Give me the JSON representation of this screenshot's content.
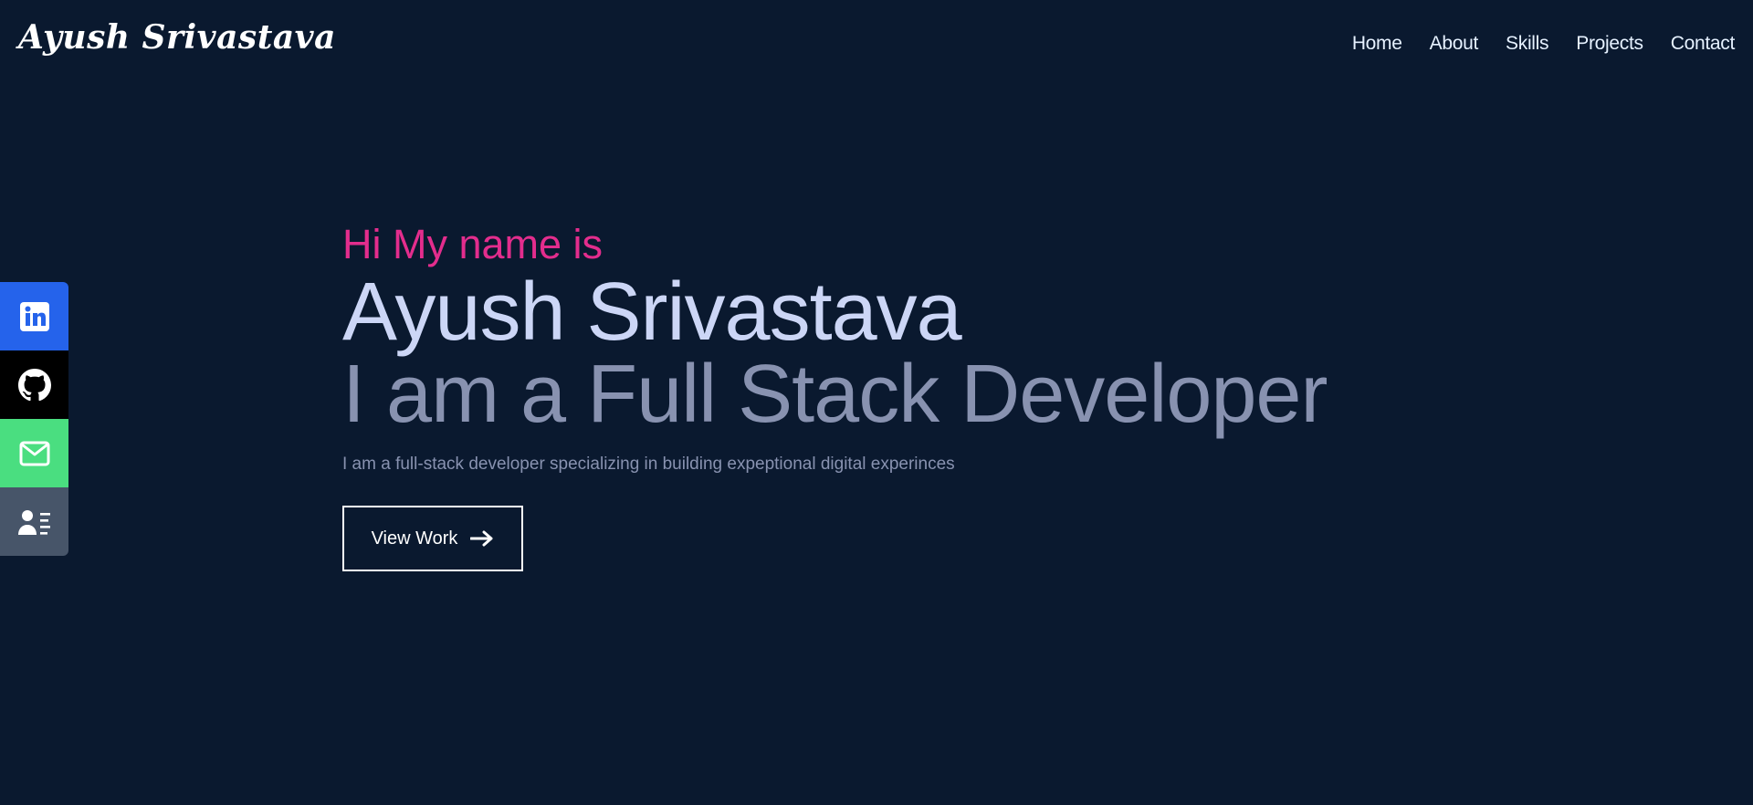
{
  "header": {
    "logo": "Ayush Srivastava",
    "nav": [
      "Home",
      "About",
      "Skills",
      "Projects",
      "Contact"
    ]
  },
  "social": [
    {
      "name": "linkedin",
      "icon": "linkedin-icon",
      "color": "#2563eb"
    },
    {
      "name": "github",
      "icon": "github-icon",
      "color": "#000000"
    },
    {
      "name": "email",
      "icon": "mail-icon",
      "color": "#4ade80"
    },
    {
      "name": "resume",
      "icon": "resume-icon",
      "color": "#475569"
    }
  ],
  "hero": {
    "greeting": "Hi My name is",
    "name": "Ayush Srivastava",
    "role": "I am a Full Stack Developer",
    "description": "I am a full-stack developer specializing in building expeptional digital experinces",
    "button_label": "View Work",
    "button_icon": "arrow-right-icon"
  },
  "colors": {
    "background": "#0a192f",
    "accent": "#e32d8d",
    "heading": "#ccd6f6",
    "muted": "#8892b0"
  }
}
